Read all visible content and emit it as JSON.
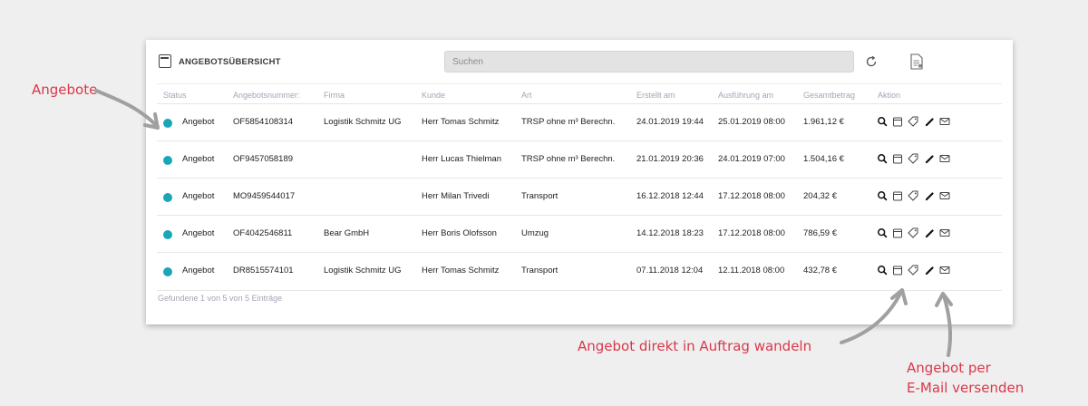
{
  "panel": {
    "title": "ANGEBOTSÜBERSICHT",
    "search_placeholder": "Suchen"
  },
  "table": {
    "headers": [
      "Status",
      "Angebotsnummer:",
      "Firma",
      "Kunde",
      "Art",
      "Erstellt am",
      "Ausführung am",
      "Gesamtbetrag",
      "Aktion"
    ],
    "rows": [
      {
        "status": "Angebot",
        "nummer": "OF5854108314",
        "firma": "Logistik Schmitz UG",
        "kunde": "Herr Tomas Schmitz",
        "art": "TRSP ohne m³ Berechn.",
        "erstellt": "24.01.2019 19:44",
        "ausfuehrung": "25.01.2019 08:00",
        "betrag": "1.961,12 €"
      },
      {
        "status": "Angebot",
        "nummer": "OF9457058189",
        "firma": "",
        "kunde": "Herr Lucas Thielman",
        "art": "TRSP ohne m³ Berechn.",
        "erstellt": "21.01.2019 20:36",
        "ausfuehrung": "24.01.2019 07:00",
        "betrag": "1.504,16 €"
      },
      {
        "status": "Angebot",
        "nummer": "MO9459544017",
        "firma": "",
        "kunde": "Herr Milan Trivedi",
        "art": "Transport",
        "erstellt": "16.12.2018 12:44",
        "ausfuehrung": "17.12.2018 08:00",
        "betrag": "204,32 €"
      },
      {
        "status": "Angebot",
        "nummer": "OF4042546811",
        "firma": "Bear GmbH",
        "kunde": "Herr Boris Olofsson",
        "art": "Umzug",
        "erstellt": "14.12.2018 18:23",
        "ausfuehrung": "17.12.2018 08:00",
        "betrag": "786,59 €"
      },
      {
        "status": "Angebot",
        "nummer": "DR8515574101",
        "firma": "Logistik Schmitz UG",
        "kunde": "Herr Tomas Schmitz",
        "art": "Transport",
        "erstellt": "07.11.2018 12:04",
        "ausfuehrung": "12.11.2018 08:00",
        "betrag": "432,78 €"
      }
    ],
    "action_icons": [
      "search-icon",
      "archive-icon",
      "tag-convert-icon",
      "edit-pencil-icon",
      "mail-icon"
    ],
    "footer": "Gefundene 1 von 5 von 5 Einträge"
  },
  "annotations": {
    "angebote": "Angebote",
    "convert": "Angebot direkt in Auftrag wandeln",
    "email_line1": "Angebot per",
    "email_line2": "E-Mail versenden"
  },
  "colors": {
    "status_dot": "#1aa6b7",
    "annotation": "#d9384a",
    "header_text": "#a4a4b8"
  }
}
